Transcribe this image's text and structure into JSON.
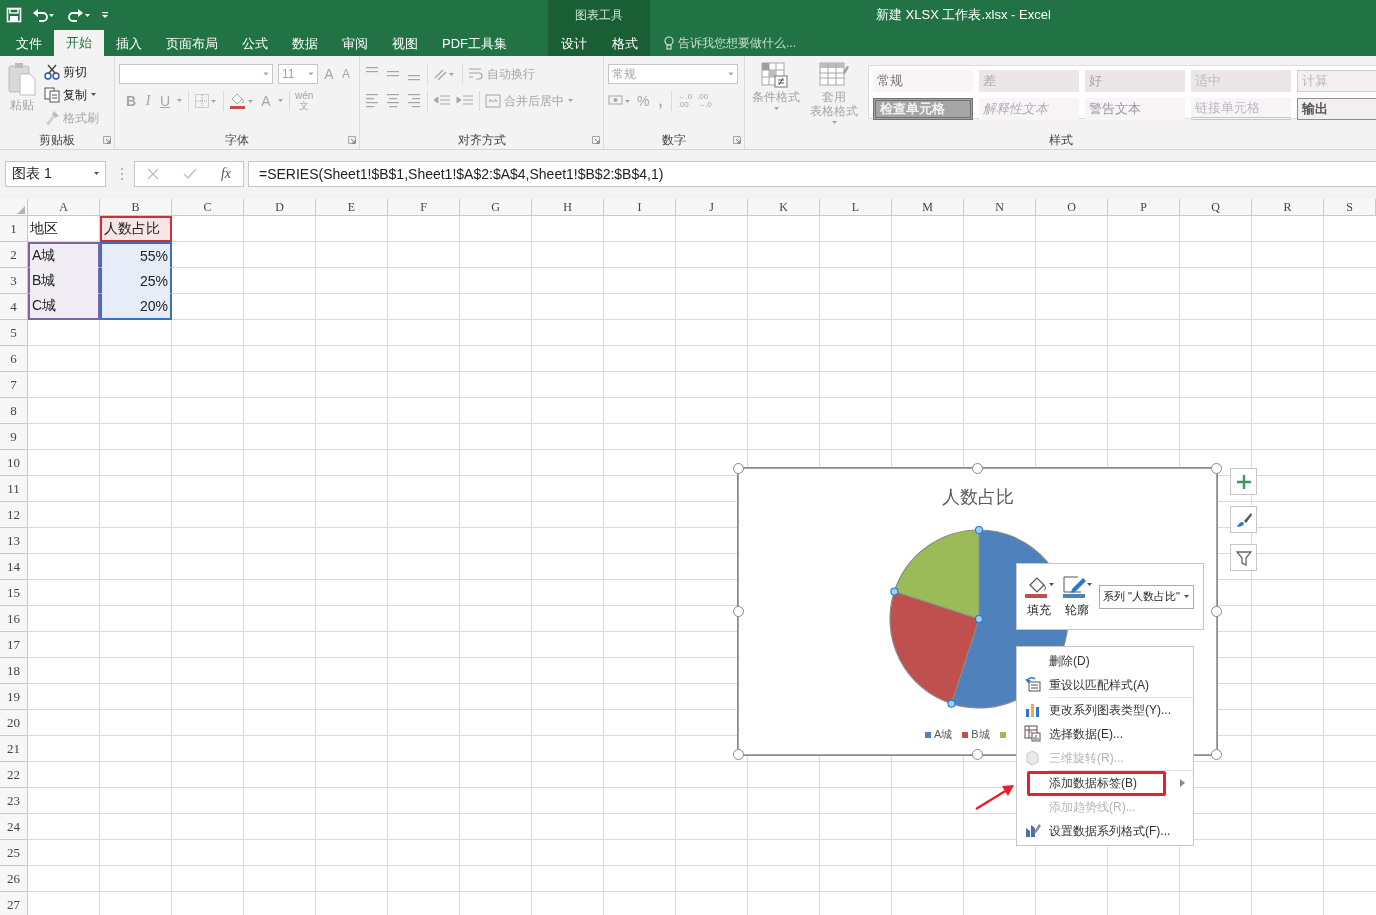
{
  "window": {
    "title": "新建 XLSX 工作表.xlsx - Excel",
    "context_label": "图表工具"
  },
  "tabs": [
    {
      "label": "文件",
      "selected": false,
      "contextual": false
    },
    {
      "label": "开始",
      "selected": true,
      "contextual": false
    },
    {
      "label": "插入",
      "selected": false,
      "contextual": false
    },
    {
      "label": "页面布局",
      "selected": false,
      "contextual": false
    },
    {
      "label": "公式",
      "selected": false,
      "contextual": false
    },
    {
      "label": "数据",
      "selected": false,
      "contextual": false
    },
    {
      "label": "审阅",
      "selected": false,
      "contextual": false
    },
    {
      "label": "视图",
      "selected": false,
      "contextual": false
    },
    {
      "label": "PDF工具集",
      "selected": false,
      "contextual": false
    },
    {
      "label": "设计",
      "selected": false,
      "contextual": true
    },
    {
      "label": "格式",
      "selected": false,
      "contextual": true
    }
  ],
  "tell_me": {
    "placeholder": "告诉我您想要做什么..."
  },
  "ribbon": {
    "clipboard": {
      "label": "剪贴板",
      "paste": {
        "label": "粘贴",
        "disabled": true
      },
      "cut": {
        "label": "剪切",
        "disabled": false
      },
      "copy": {
        "label": "复制",
        "disabled": false
      },
      "format_painter": {
        "label": "格式刷",
        "disabled": true
      }
    },
    "font": {
      "label": "字体",
      "font_size": "11",
      "grow": "A",
      "shrink": "A",
      "bold": "B",
      "italic": "I",
      "underline": "U",
      "font_color": "A",
      "phonetic_top": "wén",
      "phonetic_bottom": "文"
    },
    "alignment": {
      "label": "对齐方式",
      "wrap": {
        "label": "自动换行",
        "disabled": true
      },
      "merge": {
        "label": "合并后居中",
        "disabled": true
      }
    },
    "number": {
      "label": "数字",
      "format": "常规",
      "percent": "%",
      "comma": ",",
      "decimal_increase": {
        "top": "←.0",
        "bottom": ".00"
      },
      "decimal_decrease": {
        "top": ".00",
        "bottom": "→.0"
      }
    },
    "styles": {
      "label": "样式",
      "conditional": {
        "label": "条件格式",
        "disabled": true
      },
      "table_format": {
        "lines": [
          "套用",
          "表格格式"
        ],
        "disabled": true
      },
      "items": [
        {
          "label": "常规",
          "kind": "normal"
        },
        {
          "label": "差",
          "kind": "bad"
        },
        {
          "label": "好",
          "kind": "good"
        },
        {
          "label": "适中",
          "kind": "neutral"
        },
        {
          "label": "计算",
          "kind": "calc"
        },
        {
          "label": "检查单元格",
          "kind": "check"
        },
        {
          "label": "解释性文本",
          "kind": "explanatory"
        },
        {
          "label": "警告文本",
          "kind": "warning"
        },
        {
          "label": "链接单元格",
          "kind": "linked"
        },
        {
          "label": "输出",
          "kind": "output"
        }
      ]
    }
  },
  "formula_bar": {
    "name_box": "图表 1",
    "fx": "fx",
    "formula": "=SERIES(Sheet1!$B$1,Sheet1!$A$2:$A$4,Sheet1!$B$2:$B$4,1)"
  },
  "sheet": {
    "columns": [
      "A",
      "B",
      "C",
      "D",
      "E",
      "F",
      "G",
      "H",
      "I",
      "J",
      "K",
      "L",
      "M",
      "N",
      "O",
      "P",
      "Q",
      "R",
      "S"
    ],
    "rows": [
      {
        "header": "1",
        "cells": [
          {
            "text": "地区",
            "numeric": false
          },
          {
            "text": "人数占比",
            "numeric": false,
            "color": "#c9313a"
          }
        ]
      },
      {
        "header": "2",
        "cells": [
          {
            "text": "A城",
            "numeric": false,
            "color": "#8064a2"
          },
          {
            "text": "55%",
            "numeric": true,
            "color": "#3a6fc4"
          }
        ]
      },
      {
        "header": "3",
        "cells": [
          {
            "text": "B城",
            "numeric": false,
            "color": "#8064a2"
          },
          {
            "text": "25%",
            "numeric": true,
            "color": "#3a6fc4"
          }
        ]
      },
      {
        "header": "4",
        "cells": [
          {
            "text": "C城",
            "numeric": false,
            "color": "#8064a2"
          },
          {
            "text": "20%",
            "numeric": true,
            "color": "#3a6fc4"
          }
        ]
      },
      {
        "header": "5"
      },
      {
        "header": "6"
      },
      {
        "header": "7"
      },
      {
        "header": "8"
      },
      {
        "header": "9"
      },
      {
        "header": "10"
      },
      {
        "header": "11"
      },
      {
        "header": "12"
      },
      {
        "header": "13"
      },
      {
        "header": "14"
      },
      {
        "header": "15"
      },
      {
        "header": "16"
      },
      {
        "header": "17"
      },
      {
        "header": "18"
      },
      {
        "header": "19"
      },
      {
        "header": "20"
      },
      {
        "header": "21"
      },
      {
        "header": "22"
      },
      {
        "header": "23"
      },
      {
        "header": "24"
      },
      {
        "header": "25"
      },
      {
        "header": "26"
      },
      {
        "header": "27"
      }
    ]
  },
  "chart": {
    "title": "人数占比",
    "selected": true,
    "series_selected": true,
    "legend": [
      {
        "label": "A城",
        "color": "#4f81bd"
      },
      {
        "label": "B城",
        "color": "#c0504d"
      },
      {
        "color": "#9bbb59"
      }
    ]
  },
  "mini_toolbar": {
    "fill": "填充",
    "outline": "轮廓",
    "series": "系列 \"人数占比\""
  },
  "context_menu": [
    {
      "label": "删除(D)",
      "disabled": false,
      "submenu": false,
      "highlighted": false
    },
    {
      "label": "重设以匹配样式(A)",
      "disabled": false,
      "submenu": false,
      "highlighted": false
    },
    {
      "label": "更改系列图表类型(Y)...",
      "disabled": false,
      "submenu": false,
      "highlighted": false
    },
    {
      "label": "选择数据(E)...",
      "disabled": false,
      "submenu": false,
      "highlighted": false
    },
    {
      "label": "三维旋转(R)...",
      "disabled": true,
      "submenu": false,
      "highlighted": false
    },
    {
      "label": "添加数据标签(B)",
      "disabled": false,
      "submenu": true,
      "highlighted": true
    },
    {
      "label": "添加趋势线(R)...",
      "disabled": true,
      "submenu": false,
      "highlighted": false
    },
    {
      "label": "设置数据系列格式(F)...",
      "disabled": false,
      "submenu": false,
      "highlighted": false
    }
  ]
}
